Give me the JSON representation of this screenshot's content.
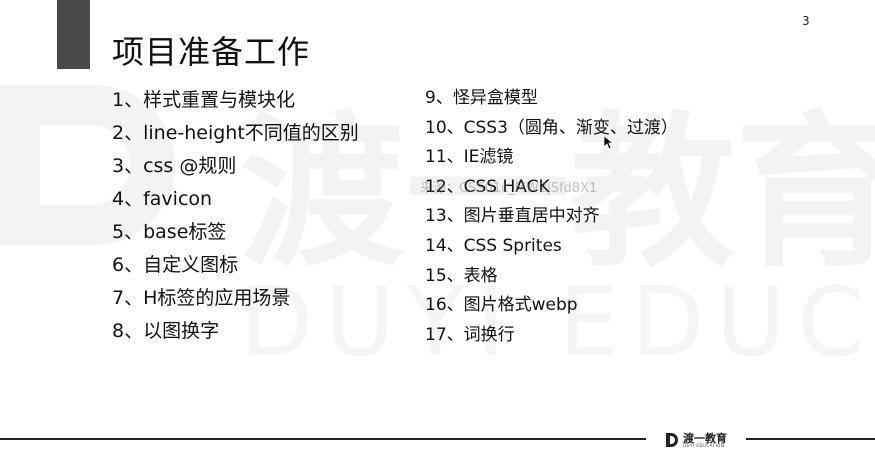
{
  "page_number": "3",
  "title": "项目准备工作",
  "left_items": [
    "1、样式重置与模块化",
    "2、line-height不同值的区别",
    "3、css @规则",
    "4、favicon",
    "5、base标签",
    "6、自定义图标",
    "7、H标签的应用场景",
    "8、以图换字"
  ],
  "right_items": [
    "9、怪异盒模型",
    "10、CSS3（圆角、渐变、过渡）",
    "11、IE滤镜",
    "12、CSS HACK",
    "13、图片垂直居中对齐",
    "14、CSS Sprites",
    "15、表格",
    "16、图片格式webp",
    "17、词换行"
  ],
  "overlay_id": "来源：CSS01c_MW2jSfd8X1",
  "watermark": {
    "cn": "渡一教育",
    "en": "DUYI EDUCATION"
  },
  "footer_logo": {
    "cn": "渡一教育",
    "en": "DUYI EDUCATION"
  },
  "colors": {
    "accent_bar": "#4a4a4a",
    "text": "#111111",
    "watermark": "#f4f4f4"
  }
}
